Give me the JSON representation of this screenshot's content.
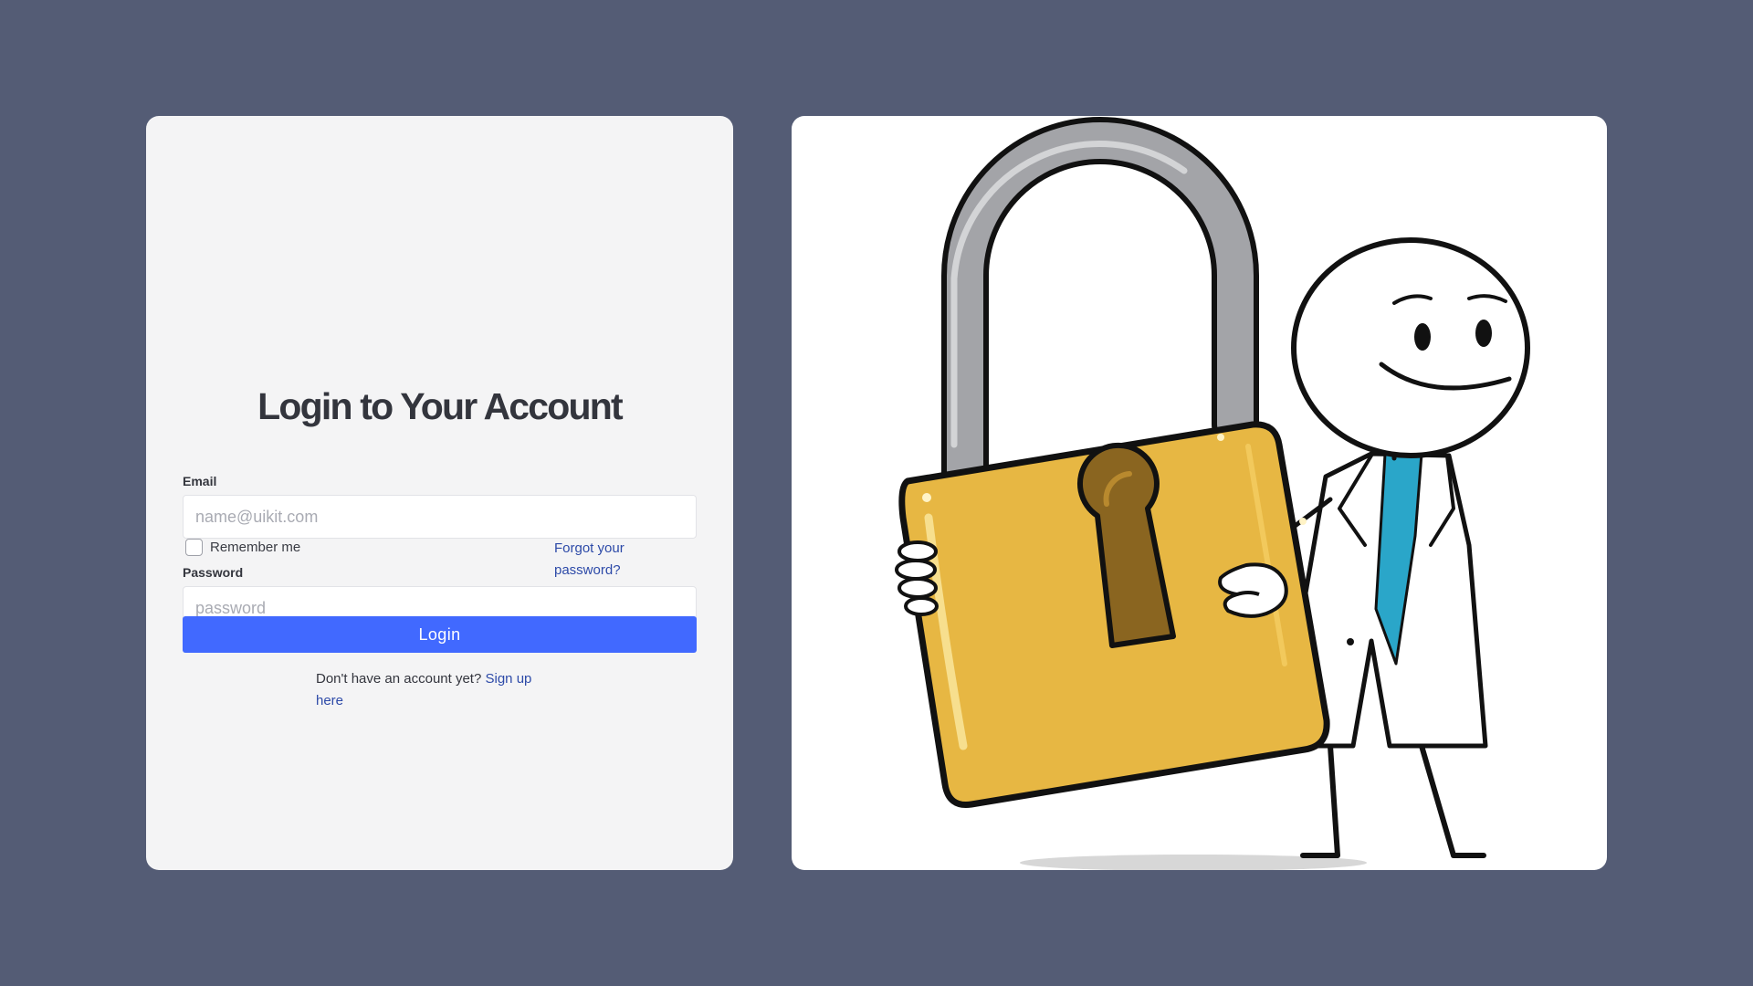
{
  "login": {
    "title": "Login to Your Account",
    "email_label": "Email",
    "email_placeholder": "name@uikit.com",
    "email_value": "",
    "password_label": "Password",
    "password_placeholder": "password",
    "password_value": "",
    "remember_label": "Remember me",
    "remember_checked": false,
    "forgot_link": "Forgot your password?",
    "button_label": "Login",
    "signup_prompt": "Don't have an account yet?",
    "signup_link": "Sign up here"
  },
  "illustration": {
    "subject": "stick figure in lab coat holding a large padlock",
    "icon": "padlock-icon"
  },
  "colors": {
    "background": "#545c75",
    "card": "#f4f4f5",
    "primary_button": "#4169ff",
    "link": "#2d4aa8",
    "lock_body": "#e7b743",
    "shackle": "#9fa0a4",
    "tie": "#2aa6c9"
  }
}
